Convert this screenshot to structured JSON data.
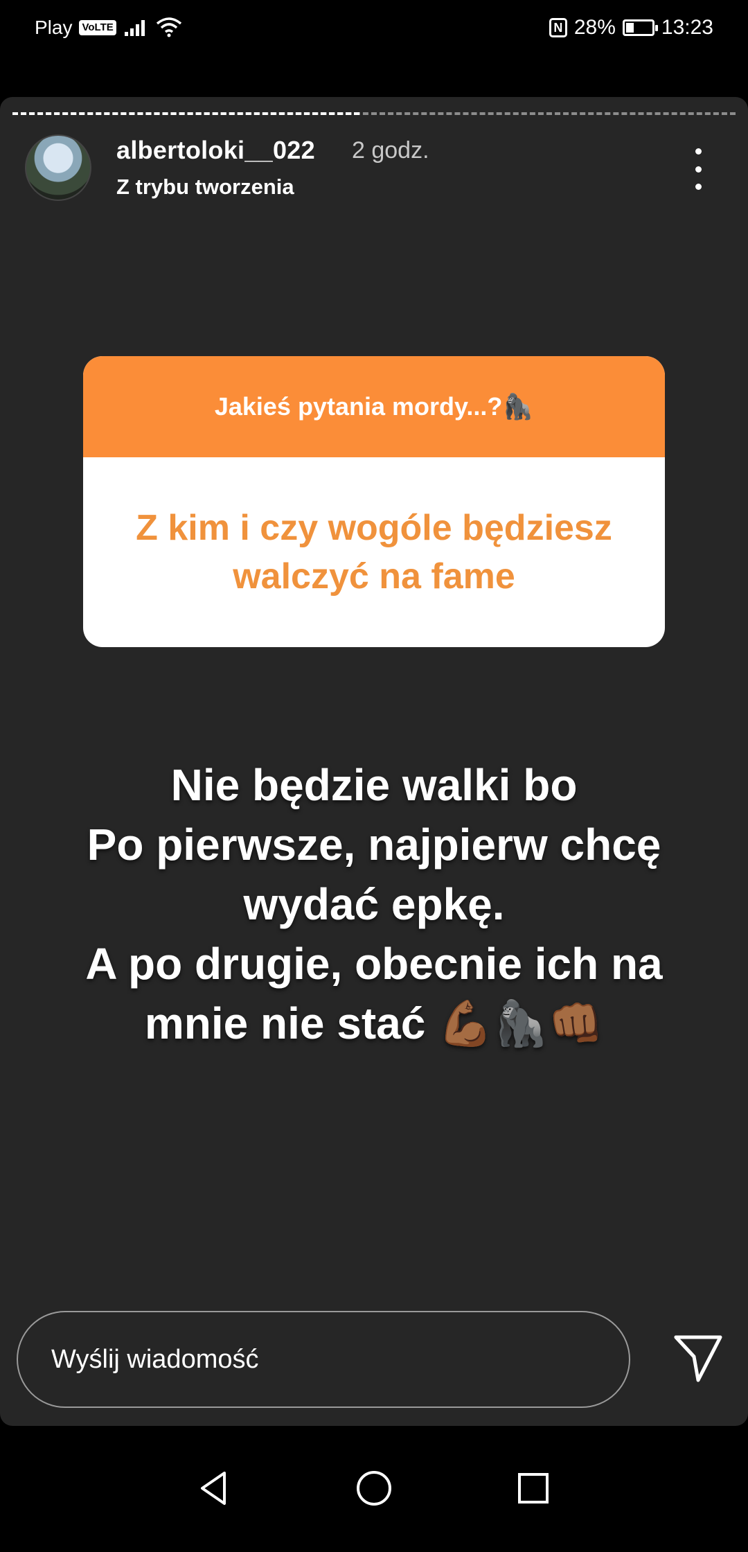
{
  "status_bar": {
    "carrier": "Play",
    "volte": "VoLTE",
    "nfc": "N",
    "battery": "28%",
    "battery_level": 0.28,
    "time": "13:23"
  },
  "story": {
    "progress_done": 0.48,
    "username": "albertoloki__022",
    "time_ago": "2 godz.",
    "subtitle": "Z trybu tworzenia",
    "question_header": "Jakieś pytania mordy...?🦍",
    "question_text": "Z kim i czy wogóle będziesz walczyć na fame",
    "answer_lines": [
      "Nie będzie walki bo",
      "Po pierwsze, najpierw chcę",
      "wydać epkę.",
      "A po drugie, obecnie ich na",
      "mnie nie stać 💪🏾🦍👊🏾"
    ]
  },
  "reply": {
    "placeholder": "Wyślij wiadomość"
  },
  "colors": {
    "sticker_header": "#fb8d38",
    "sticker_text": "#f0923c",
    "panel": "#262626"
  },
  "icons": {
    "more": "more-vertical-icon",
    "send": "send-icon",
    "back": "back-icon",
    "home": "home-icon",
    "recents": "recents-icon"
  }
}
